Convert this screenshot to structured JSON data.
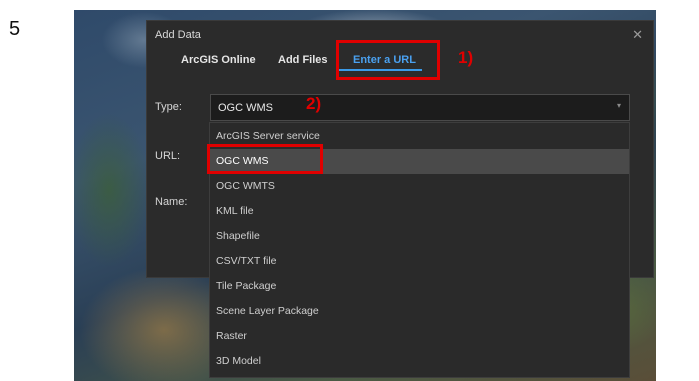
{
  "step_number": "5",
  "dialog": {
    "title": "Add Data",
    "close_glyph": "✕",
    "tabs": [
      {
        "label": "ArcGIS Online"
      },
      {
        "label": "Add Files"
      },
      {
        "label": "Enter a URL"
      }
    ],
    "type_label": "Type:",
    "url_label": "URL:",
    "name_label": "Name:",
    "selected_type": "OGC WMS",
    "chevron_glyph": "▾"
  },
  "dropdown": {
    "options": [
      "ArcGIS Server service",
      "OGC WMS",
      "OGC WMTS",
      "KML file",
      "Shapefile",
      "CSV/TXT file",
      "Tile Package",
      "Scene Layer Package",
      "Raster",
      "3D Model"
    ]
  },
  "annotations": {
    "callout_1": "1)",
    "callout_2": "2)",
    "highlight_color": "#e00000"
  },
  "colors": {
    "accent": "#4aa0ef",
    "dialog_bg": "#2b2b2b",
    "selected_item_bg": "#4a4a4a"
  }
}
